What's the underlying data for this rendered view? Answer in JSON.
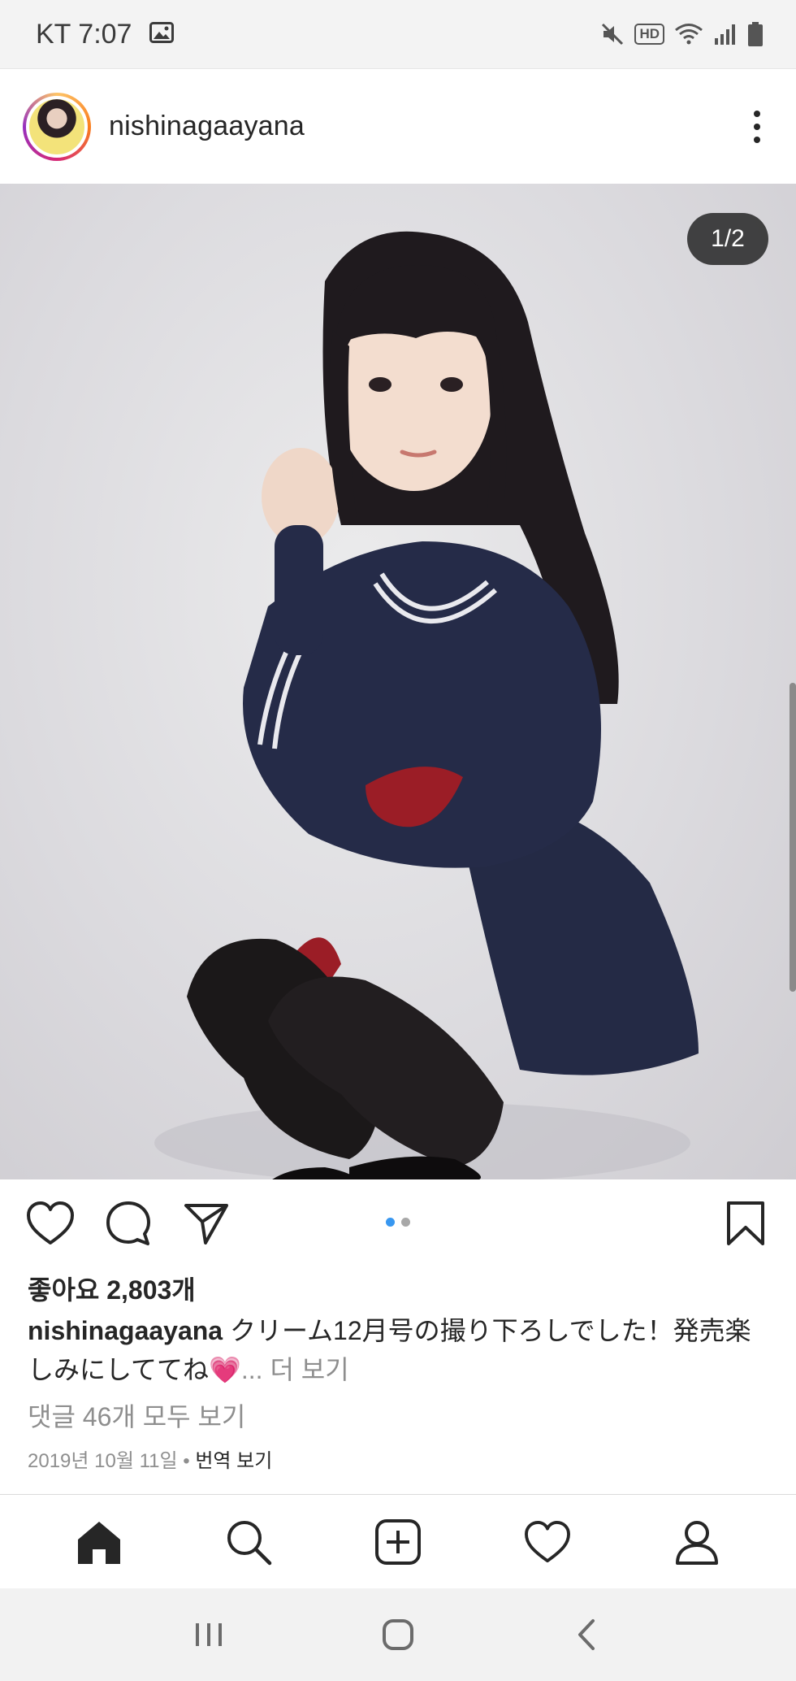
{
  "status_bar": {
    "carrier_time": "KT 7:07",
    "hd_label": "HD",
    "icons": [
      "gallery-icon",
      "mute-icon",
      "wifi-icon",
      "signal-icon",
      "battery-icon"
    ]
  },
  "post": {
    "username": "nishinagaayana",
    "image_counter": "1/2",
    "carousel": {
      "total": 2,
      "active": 1
    },
    "likes": "좋아요 2,803개",
    "caption_user": "nishinagaayana",
    "caption_text": "クリーム12月号の撮り下ろしでした！発売楽しみにしててね",
    "caption_emoji": "💗",
    "caption_more": "... 더 보기",
    "comments_link": "댓글 46개 모두 보기",
    "date": "2019년 10월 11일",
    "date_separator": " • ",
    "translate_link": "번역 보기"
  },
  "colors": {
    "text": "#262626",
    "muted": "#8e8e8e",
    "accent_blue": "#3897f0"
  },
  "bottom_nav": [
    "home-icon",
    "search-icon",
    "new-post-icon",
    "activity-icon",
    "profile-icon"
  ],
  "system_nav": [
    "recent-apps-icon",
    "home-button-icon",
    "back-icon"
  ]
}
